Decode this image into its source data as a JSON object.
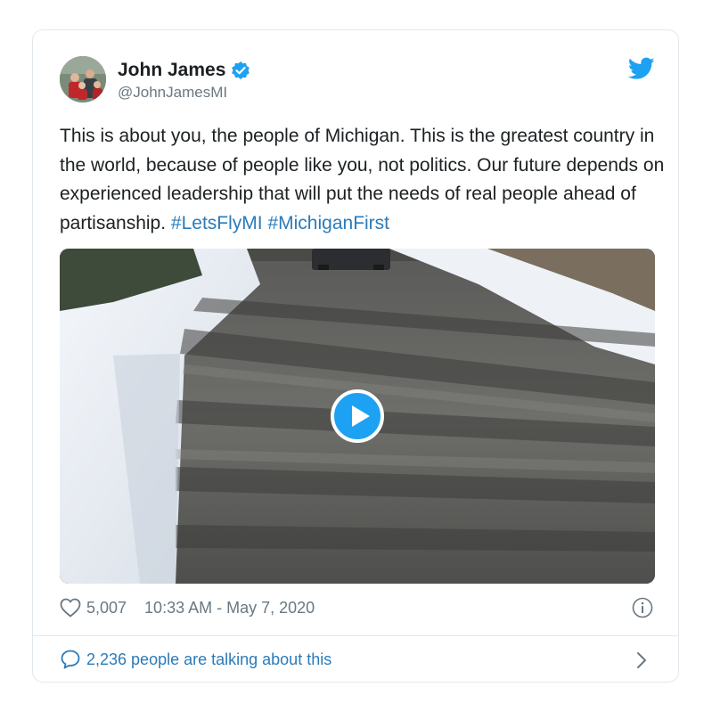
{
  "author": {
    "name": "John James",
    "handle": "@JohnJamesMI",
    "avatar_icon": "profile-photo",
    "verified_icon": "verified-badge-icon"
  },
  "brand": {
    "icon": "twitter-bird-icon",
    "color": "#1da1f2"
  },
  "tweet": {
    "text": "This is about you, the people of Michigan. This is the greatest country in the world, because of people like you, not politics. Our future depends on experienced leadership that will put the needs of real people ahead of partisanship.",
    "hashtags": [
      "#LetsFlyMI",
      "#MichiganFirst"
    ],
    "link_color": "#2b7bb9"
  },
  "media": {
    "type": "video",
    "play_icon": "play-icon"
  },
  "stats": {
    "likes": "5,007",
    "timestamp": "10:33 AM - May 7, 2020",
    "like_icon": "heart-icon",
    "info_icon": "info-icon"
  },
  "footer": {
    "talking": "2,236 people are talking about this",
    "bubble_icon": "speech-bubble-icon",
    "chevron_icon": "chevron-right-icon"
  }
}
